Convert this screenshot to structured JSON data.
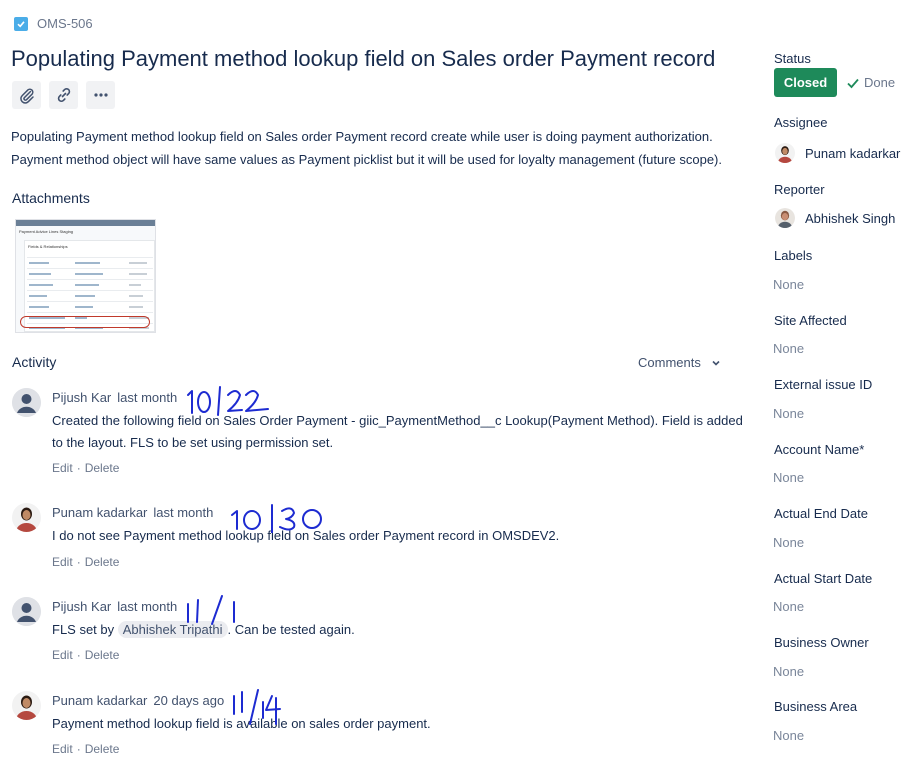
{
  "issue": {
    "key": "OMS-506",
    "title": "Populating Payment method lookup field on Sales order Payment record",
    "description_lines": [
      "Populating Payment method lookup field on Sales order Payment record create while user is doing payment authorization.",
      "Payment method object will have same values as Payment picklist but it will be used for loyalty management (future scope)."
    ]
  },
  "toolbar": {
    "icons": [
      "paperclip-icon",
      "link-icon",
      "more-icon"
    ]
  },
  "attachments": {
    "title": "Attachments",
    "thumbnail_text": {
      "header": "Payment Advice Lines Staging",
      "panel_title": "Fields & Relationships"
    }
  },
  "activity": {
    "title": "Activity",
    "filter_label": "Comments",
    "comments": [
      {
        "author": "Pijush Kar",
        "time": "last month",
        "handwritten_note": "10/22",
        "body_lines": [
          "Created the following field on Sales Order Payment - giic_PaymentMethod__c Lookup(Payment Method). Field is added",
          "to the layout. FLS to be set using permission set."
        ],
        "edit": "Edit",
        "delete": "Delete"
      },
      {
        "author": "Punam kadarkar",
        "time": "last month",
        "handwritten_note": "10/30",
        "body_lines": [
          "I do not see Payment method lookup field on Sales order Payment record in OMSDEV2."
        ],
        "edit": "Edit",
        "delete": "Delete"
      },
      {
        "author": "Pijush Kar",
        "time": "last month",
        "handwritten_note": "11/1",
        "body_prefix": "FLS set by",
        "mention": "Abhishek Tripathi",
        "body_suffix": ". Can be tested again.",
        "edit": "Edit",
        "delete": "Delete"
      },
      {
        "author": "Punam kadarkar",
        "time": "20 days ago",
        "handwritten_note": "11/14",
        "body_lines": [
          "Payment method lookup field is available on sales order payment."
        ],
        "edit": "Edit",
        "delete": "Delete"
      }
    ]
  },
  "sidebar": {
    "status_label": "Status",
    "status_value": "Closed",
    "resolution": "Done",
    "assignee_label": "Assignee",
    "assignee": "Punam kadarkar",
    "reporter_label": "Reporter",
    "reporter": "Abhishek Singh",
    "fields": [
      {
        "label": "Labels",
        "value": "None"
      },
      {
        "label": "Site Affected",
        "value": "None"
      },
      {
        "label": "External issue ID",
        "value": "None"
      },
      {
        "label": "Account Name*",
        "value": "None"
      },
      {
        "label": "Actual End Date",
        "value": "None"
      },
      {
        "label": "Actual Start Date",
        "value": "None"
      },
      {
        "label": "Business Owner",
        "value": "None"
      },
      {
        "label": "Business Area",
        "value": "None"
      }
    ]
  },
  "colors": {
    "status_closed": "#1e8a5a",
    "issue_type": "#4bade8",
    "handwriting_ink": "#1d2bd1"
  }
}
